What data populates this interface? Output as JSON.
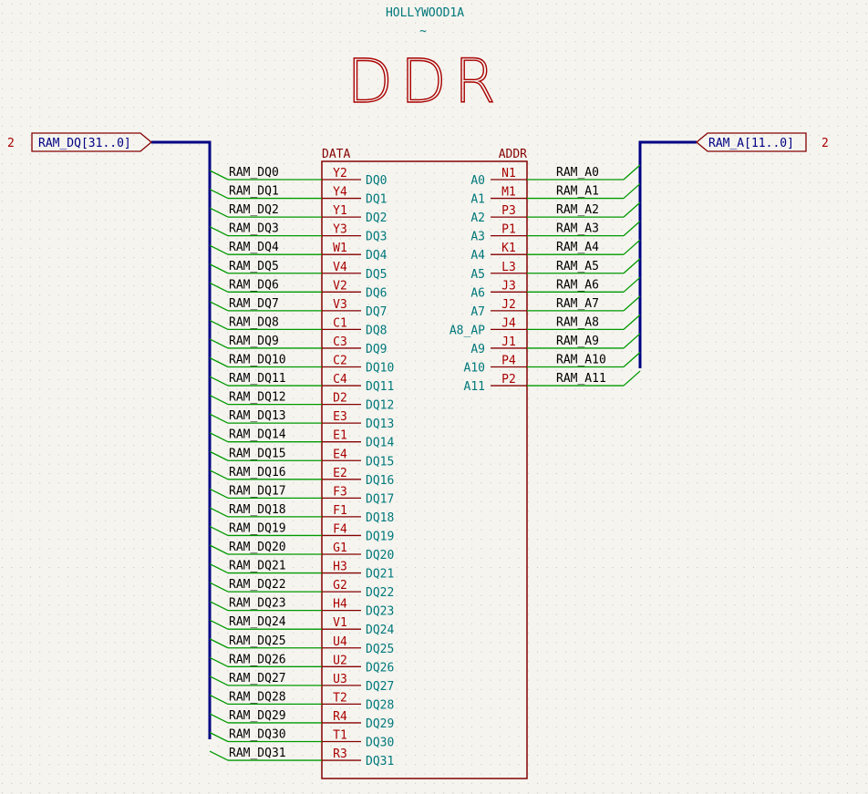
{
  "component": {
    "reference": "HOLLYWOOD1A",
    "value": "~",
    "title": "DDR",
    "data_group_label": "DATA",
    "addr_group_label": "ADDR"
  },
  "hier_labels": {
    "dq_bus": {
      "text": "RAM_DQ[31..0]",
      "sheet_ref": "2"
    },
    "addr_bus": {
      "text": "RAM_A[11..0]",
      "sheet_ref": "2"
    }
  },
  "data_pins": [
    {
      "net": "RAM_DQ0",
      "pin": "Y2",
      "name": "DQ0"
    },
    {
      "net": "RAM_DQ1",
      "pin": "Y4",
      "name": "DQ1"
    },
    {
      "net": "RAM_DQ2",
      "pin": "Y1",
      "name": "DQ2"
    },
    {
      "net": "RAM_DQ3",
      "pin": "Y3",
      "name": "DQ3"
    },
    {
      "net": "RAM_DQ4",
      "pin": "W1",
      "name": "DQ4"
    },
    {
      "net": "RAM_DQ5",
      "pin": "V4",
      "name": "DQ5"
    },
    {
      "net": "RAM_DQ6",
      "pin": "V2",
      "name": "DQ6"
    },
    {
      "net": "RAM_DQ7",
      "pin": "V3",
      "name": "DQ7"
    },
    {
      "net": "RAM_DQ8",
      "pin": "C1",
      "name": "DQ8"
    },
    {
      "net": "RAM_DQ9",
      "pin": "C3",
      "name": "DQ9"
    },
    {
      "net": "RAM_DQ10",
      "pin": "C2",
      "name": "DQ10"
    },
    {
      "net": "RAM_DQ11",
      "pin": "C4",
      "name": "DQ11"
    },
    {
      "net": "RAM_DQ12",
      "pin": "D2",
      "name": "DQ12"
    },
    {
      "net": "RAM_DQ13",
      "pin": "E3",
      "name": "DQ13"
    },
    {
      "net": "RAM_DQ14",
      "pin": "E1",
      "name": "DQ14"
    },
    {
      "net": "RAM_DQ15",
      "pin": "E4",
      "name": "DQ15"
    },
    {
      "net": "RAM_DQ16",
      "pin": "E2",
      "name": "DQ16"
    },
    {
      "net": "RAM_DQ17",
      "pin": "F3",
      "name": "DQ17"
    },
    {
      "net": "RAM_DQ18",
      "pin": "F1",
      "name": "DQ18"
    },
    {
      "net": "RAM_DQ19",
      "pin": "F4",
      "name": "DQ19"
    },
    {
      "net": "RAM_DQ20",
      "pin": "G1",
      "name": "DQ20"
    },
    {
      "net": "RAM_DQ21",
      "pin": "H3",
      "name": "DQ21"
    },
    {
      "net": "RAM_DQ22",
      "pin": "G2",
      "name": "DQ22"
    },
    {
      "net": "RAM_DQ23",
      "pin": "H4",
      "name": "DQ23"
    },
    {
      "net": "RAM_DQ24",
      "pin": "V1",
      "name": "DQ24"
    },
    {
      "net": "RAM_DQ25",
      "pin": "U4",
      "name": "DQ25"
    },
    {
      "net": "RAM_DQ26",
      "pin": "U2",
      "name": "DQ26"
    },
    {
      "net": "RAM_DQ27",
      "pin": "U3",
      "name": "DQ27"
    },
    {
      "net": "RAM_DQ28",
      "pin": "T2",
      "name": "DQ28"
    },
    {
      "net": "RAM_DQ29",
      "pin": "R4",
      "name": "DQ29"
    },
    {
      "net": "RAM_DQ30",
      "pin": "T1",
      "name": "DQ30"
    },
    {
      "net": "RAM_DQ31",
      "pin": "R3",
      "name": "DQ31"
    }
  ],
  "addr_pins": [
    {
      "net": "RAM_A0",
      "pin": "N1",
      "name": "A0"
    },
    {
      "net": "RAM_A1",
      "pin": "M1",
      "name": "A1"
    },
    {
      "net": "RAM_A2",
      "pin": "P3",
      "name": "A2"
    },
    {
      "net": "RAM_A3",
      "pin": "P1",
      "name": "A3"
    },
    {
      "net": "RAM_A4",
      "pin": "K1",
      "name": "A4"
    },
    {
      "net": "RAM_A5",
      "pin": "L3",
      "name": "A5"
    },
    {
      "net": "RAM_A6",
      "pin": "J3",
      "name": "A6"
    },
    {
      "net": "RAM_A7",
      "pin": "J2",
      "name": "A7"
    },
    {
      "net": "RAM_A8",
      "pin": "J4",
      "name": "A8_AP"
    },
    {
      "net": "RAM_A9",
      "pin": "J1",
      "name": "A9"
    },
    {
      "net": "RAM_A10",
      "pin": "P4",
      "name": "A10"
    },
    {
      "net": "RAM_A11",
      "pin": "P2",
      "name": "A11"
    }
  ],
  "colors": {
    "background": "#f5f4ef",
    "grid_dot": "#c4c2ba",
    "body_outline": "#840000",
    "pin_line": "#840000",
    "pin_number": "#a90000",
    "pin_name": "#00787a",
    "wire": "#009900",
    "bus": "#000084",
    "net_label": "#000000",
    "hier_label": "#000084",
    "reference": "#00787a",
    "title": "#a90000"
  }
}
